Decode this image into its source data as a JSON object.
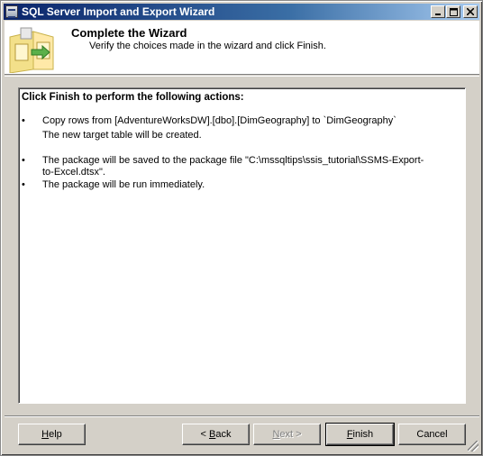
{
  "window": {
    "title": "SQL Server Import and Export Wizard",
    "controls": {
      "minimize_icon": "minimize-icon",
      "maximize_icon": "maximize-icon",
      "close_icon": "close-icon"
    }
  },
  "header": {
    "title": "Complete the Wizard",
    "subtitle": "Verify the choices made in the wizard and click Finish.",
    "graphic_icon": "wizard-graphic-icon"
  },
  "summary": {
    "heading": "Click Finish to perform the following actions:",
    "items": [
      {
        "bullet": "•",
        "text": "Copy rows from [AdventureWorksDW].[dbo].[DimGeography] to `DimGeography`",
        "sub": "The new target table will be created."
      },
      {
        "bullet": "•",
        "text": "The package will be saved to the package file \"C:\\mssqltips\\ssis_tutorial\\SSMS-Export-to-Excel.dtsx\"."
      },
      {
        "bullet": "•",
        "text": "The package will be run immediately."
      }
    ]
  },
  "buttons": {
    "help": {
      "label_u": "H",
      "label_rest": "elp"
    },
    "back": {
      "prefix": "< ",
      "label_u": "B",
      "label_rest": "ack"
    },
    "next": {
      "label_u": "N",
      "label_rest": "ext >",
      "enabled": false
    },
    "finish": {
      "label_u": "F",
      "label_rest": "inish"
    },
    "cancel": {
      "label": "Cancel"
    }
  },
  "colors": {
    "titlebar_start": "#0a246a",
    "titlebar_end": "#a6caf0",
    "dialog_face": "#d4d0c8"
  }
}
